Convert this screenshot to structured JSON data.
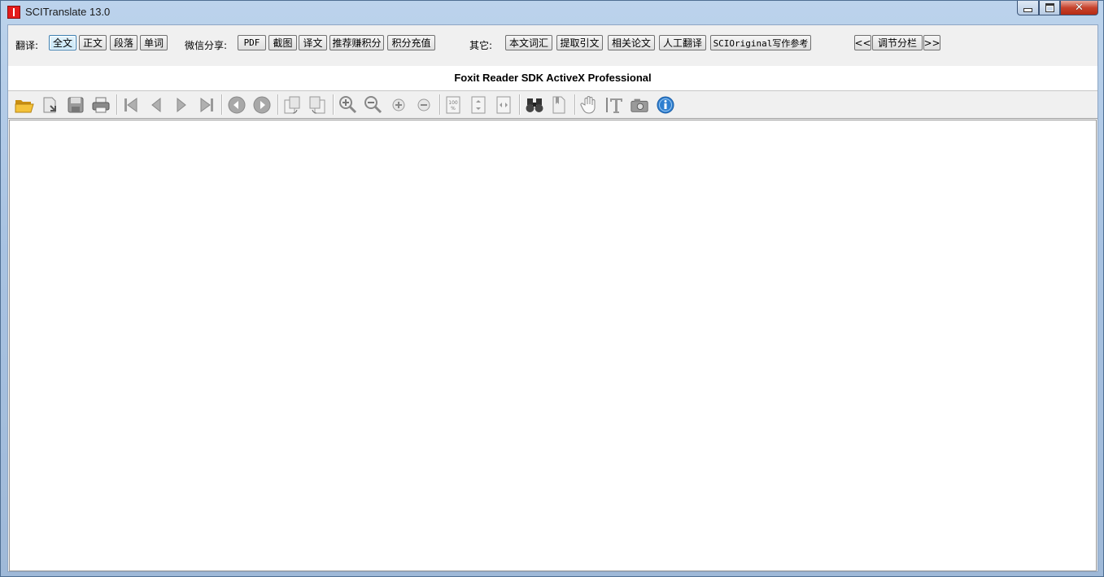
{
  "window": {
    "title": "SCITranslate 13.0"
  },
  "translate_group": {
    "label": "翻译:",
    "buttons": [
      "全文",
      "正文",
      "段落",
      "单词"
    ]
  },
  "wechat_group": {
    "label": "微信分享:",
    "buttons": [
      "PDF",
      "截图",
      "译文",
      "推荐赚积分",
      "积分充值"
    ]
  },
  "other_group": {
    "label": "其它:",
    "buttons": [
      "本文词汇",
      "提取引文",
      "相关论文",
      "人工翻译",
      "SCIOriginal写作参考"
    ]
  },
  "layout_group": {
    "prev": "<<",
    "adjust": "调节分栏",
    "next": ">>"
  },
  "viewer": {
    "title": "Foxit Reader SDK ActiveX Professional"
  },
  "toolbar_icons": [
    "open-folder-icon",
    "open-file-icon",
    "save-icon",
    "print-icon",
    "first-page-icon",
    "previous-page-icon",
    "next-page-icon",
    "last-page-icon",
    "back-icon",
    "forward-icon",
    "rotate-left-icon",
    "rotate-right-icon",
    "zoom-in-icon",
    "zoom-out-icon",
    "zoom-in-small-icon",
    "zoom-out-small-icon",
    "actual-size-icon",
    "fit-page-icon",
    "fit-width-icon",
    "find-icon",
    "bookmark-icon",
    "hand-tool-icon",
    "text-select-icon",
    "snapshot-icon",
    "info-icon"
  ],
  "colors": {
    "accent": "#3c7fb1",
    "app_icon": "#e41b1b",
    "info_icon": "#2f7fd0"
  }
}
